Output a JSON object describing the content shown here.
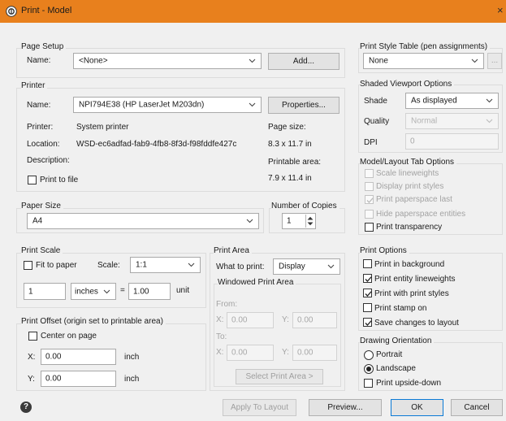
{
  "window": {
    "title": "Print - Model",
    "close_glyph": "×"
  },
  "page_setup": {
    "section": "Page Setup",
    "name_label": "Name:",
    "name_value": "<None>",
    "add_button": "Add..."
  },
  "printer": {
    "section": "Printer",
    "name_label": "Name:",
    "name_value": "NPI794E38 (HP LaserJet M203dn)",
    "properties_button": "Properties...",
    "printer_label": "Printer:",
    "printer_value": "System printer",
    "location_label": "Location:",
    "location_value": "WSD-ec6adfad-fab9-4fb8-8f3d-f98fddfe427c",
    "description_label": "Description:",
    "print_to_file": "Print to file",
    "page_size_label": "Page size:",
    "page_size_value": "8.3 x 11.7 in",
    "printable_area_label": "Printable area:",
    "printable_area_value": "7.9 x 11.4 in"
  },
  "paper_size": {
    "section": "Paper Size",
    "value": "A4"
  },
  "copies": {
    "section": "Number of Copies",
    "value": "1"
  },
  "print_scale": {
    "section": "Print Scale",
    "fit_to_paper": "Fit to paper",
    "scale_label": "Scale:",
    "scale_value": "1:1",
    "value_left": "1",
    "units_value": "inches",
    "equals": "=",
    "value_right": "1.00",
    "unit_label": "unit"
  },
  "print_offset": {
    "section": "Print Offset (origin set to printable area)",
    "center_on_page": "Center on page",
    "x_label": "X:",
    "x_value": "0.00",
    "x_unit": "inch",
    "y_label": "Y:",
    "y_value": "0.00",
    "y_unit": "inch"
  },
  "print_area": {
    "section": "Print Area",
    "what_label": "What to print:",
    "what_value": "Display",
    "windowed_section": "Windowed Print Area",
    "from_label": "From:",
    "to_label": "To:",
    "x_label": "X:",
    "y_label": "Y:",
    "from_x": "0.00",
    "from_y": "0.00",
    "to_x": "0.00",
    "to_y": "0.00",
    "select_button": "Select Print Area >"
  },
  "pen": {
    "section": "Print Style Table (pen assignments)",
    "value": "None",
    "edit_button": "..."
  },
  "shaded": {
    "section": "Shaded Viewport Options",
    "shade_label": "Shade",
    "shade_value": "As displayed",
    "quality_label": "Quality",
    "quality_value": "Normal",
    "dpi_label": "DPI",
    "dpi_value": "0"
  },
  "model_layout": {
    "section": "Model/Layout Tab Options",
    "items": [
      {
        "label": "Scale lineweights",
        "checked": false,
        "enabled": false
      },
      {
        "label": "Display print styles",
        "checked": false,
        "enabled": false
      },
      {
        "label": "Print paperspace last",
        "checked": true,
        "enabled": false
      },
      {
        "label": "Hide paperspace entities",
        "checked": false,
        "enabled": false
      },
      {
        "label": "Print transparency",
        "checked": false,
        "enabled": true
      }
    ]
  },
  "print_options": {
    "section": "Print Options",
    "items": [
      {
        "label": "Print in background",
        "checked": false
      },
      {
        "label": "Print entity lineweights",
        "checked": true
      },
      {
        "label": "Print with print styles",
        "checked": true
      },
      {
        "label": "Print stamp on",
        "checked": false
      },
      {
        "label": "Save changes to layout",
        "checked": true
      }
    ]
  },
  "orientation": {
    "section": "Drawing Orientation",
    "portrait": "Portrait",
    "landscape": "Landscape",
    "upside_down": "Print upside-down"
  },
  "footer": {
    "help_glyph": "?",
    "apply_button": "Apply To Layout",
    "preview_button": "Preview...",
    "ok_button": "OK",
    "cancel_button": "Cancel"
  }
}
